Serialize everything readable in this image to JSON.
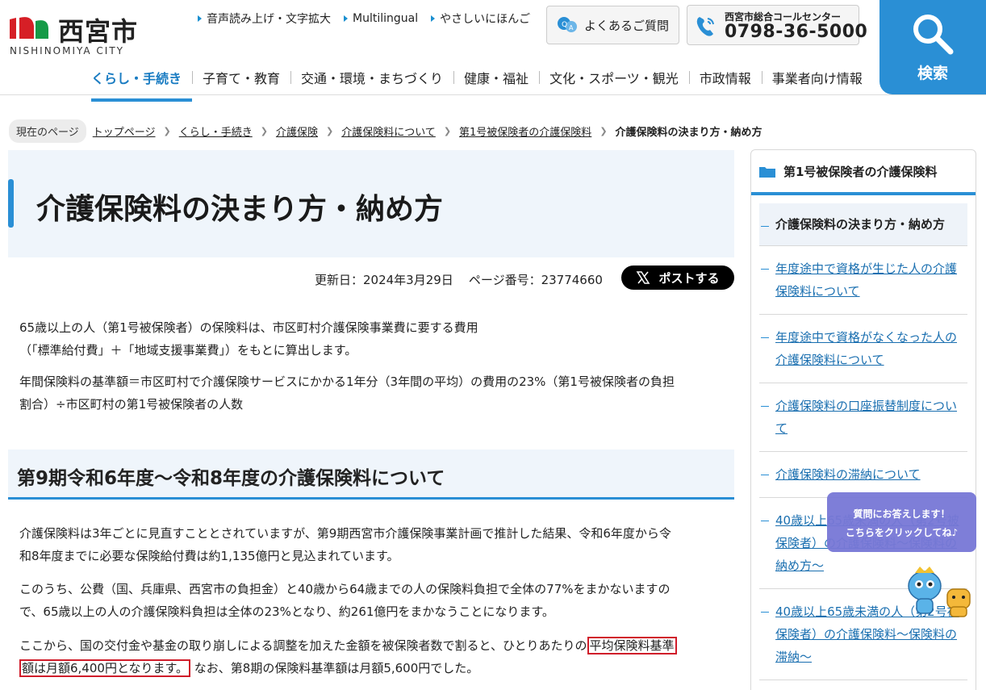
{
  "header": {
    "logo_text": "西宮市",
    "logo_sub": "NISHINOMIYA CITY",
    "util_links": [
      "音声読み上げ・文字拡大",
      "Multilingual",
      "やさしいにほんご"
    ],
    "faq_label": "よくあるご質問",
    "call_label": "西宮市総合コールセンター",
    "call_number": "0798-36-5000",
    "search_label": "検索",
    "nav": [
      "くらし・手続き",
      "子育て・教育",
      "交通・環境・まちづくり",
      "健康・福祉",
      "文化・スポーツ・観光",
      "市政情報",
      "事業者向け情報"
    ]
  },
  "breadcrumb": {
    "tag": "現在のページ",
    "items": [
      "トップページ",
      "くらし・手続き",
      "介護保険",
      "介護保険料について",
      "第1号被保険者の介護保険料"
    ],
    "current": "介護保険料の決まり方・納め方"
  },
  "main": {
    "title": "介護保険料の決まり方・納め方",
    "updated": "更新日：2024年3月29日",
    "page_number": "ページ番号：23774660",
    "post_label": "ポストする",
    "intro_1a": "65歳以上の人（第1号被保険者）の保険料は、市区町村介護保険事業費に要する費用",
    "intro_1b": "（「標準給付費」＋「地域支援事業費」）をもとに算出します。",
    "intro_2a": "年間保険料の基準額＝市区町村で介護保険サービスにかかる1年分（3年間の平均）の費用の23%（第1号被保険者の負担",
    "intro_2b": "割合）÷市区町村の第1号被保険者の人数",
    "h2": "第9期令和6年度～令和8年度の介護保険料について",
    "body_1a": "介護保険料は3年ごとに見直すこととされていますが、第9期西宮市介護保険事業計画で推計した結果、令和6年度から令",
    "body_1b": "和8年度までに必要な保険給付費は約1,135億円と見込まれています。",
    "body_2a": "このうち、公費（国、兵庫県、西宮市の負担金）と40歳から64歳までの人の保険料負担で全体の77%をまかないますの",
    "body_2b": "で、65歳以上の人の介護保険料負担は全体の23%となり、約261億円をまかなうことになります。",
    "body_3a": "ここから、国の交付金や基金の取り崩しによる調整を加えた金額を被保険者数で割ると、ひとりあたりの",
    "body_3a_hl": "平均保険料基準",
    "body_3b_hl": "額は月額6,400円となります。",
    "body_3b": "なお、第8期の保険料基準額は月額5,600円でした。"
  },
  "sidebar": {
    "heading": "第1号被保険者の介護保険料",
    "active": "介護保険料の決まり方・納め方",
    "items": [
      "年度途中で資格が生じた人の介護保険料について",
      "年度途中で資格がなくなった人の介護保険料について",
      "介護保険料の口座振替制度について",
      "介護保険料の滞納について",
      "40歳以上65歳未満の人（第2号被保険者）の介護保険料～保険料の納め方～",
      "40歳以上65歳未満の人（第2号被保険者）の介護保険料～保険料の滞納～"
    ]
  },
  "chat": {
    "line1": "質問にお答えします！",
    "line2": "こちらをクリックしてね♪"
  },
  "colors": {
    "accent": "#2a8fd5",
    "highlight": "#d01c2a",
    "chat": "#7878d6"
  }
}
